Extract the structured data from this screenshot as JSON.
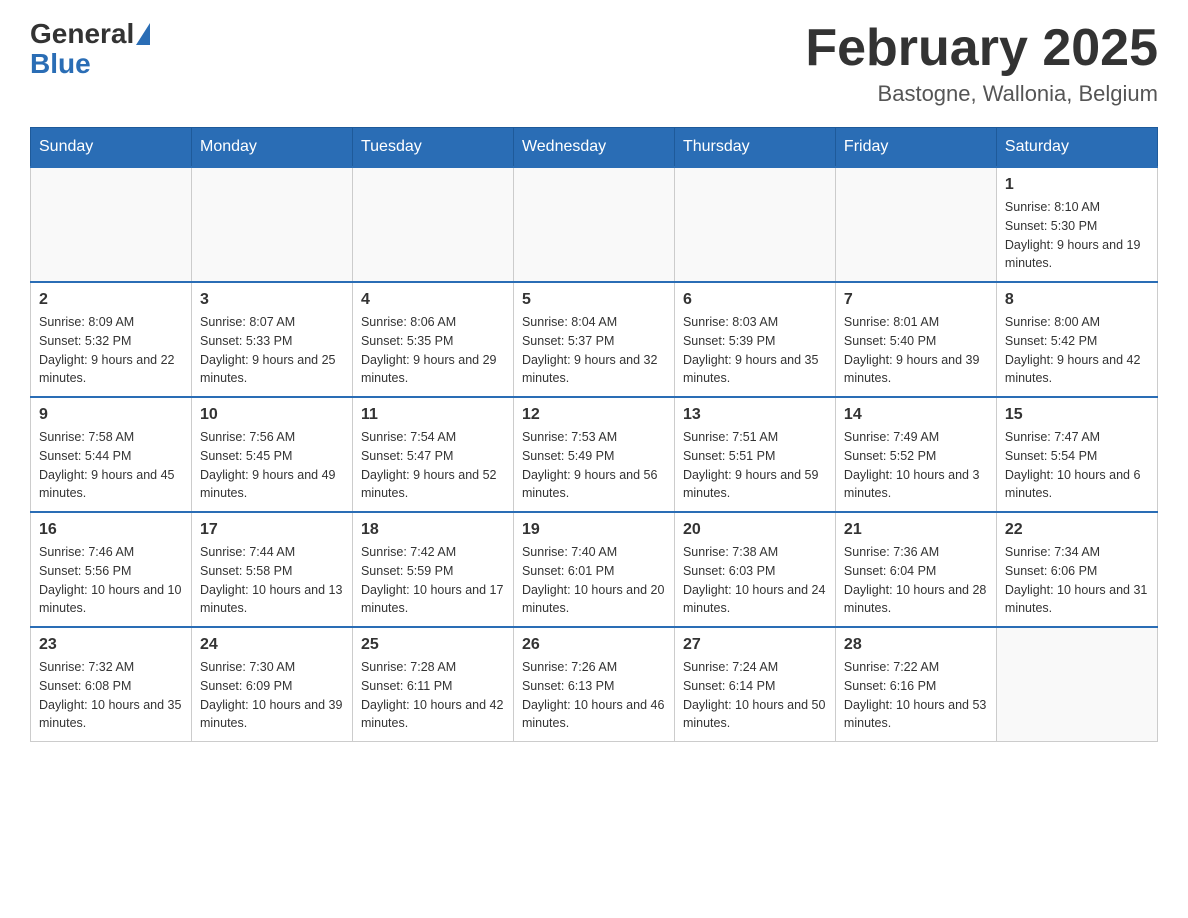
{
  "header": {
    "logo": {
      "part1": "General",
      "part2": "Blue"
    },
    "title": "February 2025",
    "location": "Bastogne, Wallonia, Belgium"
  },
  "days_of_week": [
    "Sunday",
    "Monday",
    "Tuesday",
    "Wednesday",
    "Thursday",
    "Friday",
    "Saturday"
  ],
  "weeks": [
    [
      {
        "day": "",
        "info": ""
      },
      {
        "day": "",
        "info": ""
      },
      {
        "day": "",
        "info": ""
      },
      {
        "day": "",
        "info": ""
      },
      {
        "day": "",
        "info": ""
      },
      {
        "day": "",
        "info": ""
      },
      {
        "day": "1",
        "info": "Sunrise: 8:10 AM\nSunset: 5:30 PM\nDaylight: 9 hours and 19 minutes."
      }
    ],
    [
      {
        "day": "2",
        "info": "Sunrise: 8:09 AM\nSunset: 5:32 PM\nDaylight: 9 hours and 22 minutes."
      },
      {
        "day": "3",
        "info": "Sunrise: 8:07 AM\nSunset: 5:33 PM\nDaylight: 9 hours and 25 minutes."
      },
      {
        "day": "4",
        "info": "Sunrise: 8:06 AM\nSunset: 5:35 PM\nDaylight: 9 hours and 29 minutes."
      },
      {
        "day": "5",
        "info": "Sunrise: 8:04 AM\nSunset: 5:37 PM\nDaylight: 9 hours and 32 minutes."
      },
      {
        "day": "6",
        "info": "Sunrise: 8:03 AM\nSunset: 5:39 PM\nDaylight: 9 hours and 35 minutes."
      },
      {
        "day": "7",
        "info": "Sunrise: 8:01 AM\nSunset: 5:40 PM\nDaylight: 9 hours and 39 minutes."
      },
      {
        "day": "8",
        "info": "Sunrise: 8:00 AM\nSunset: 5:42 PM\nDaylight: 9 hours and 42 minutes."
      }
    ],
    [
      {
        "day": "9",
        "info": "Sunrise: 7:58 AM\nSunset: 5:44 PM\nDaylight: 9 hours and 45 minutes."
      },
      {
        "day": "10",
        "info": "Sunrise: 7:56 AM\nSunset: 5:45 PM\nDaylight: 9 hours and 49 minutes."
      },
      {
        "day": "11",
        "info": "Sunrise: 7:54 AM\nSunset: 5:47 PM\nDaylight: 9 hours and 52 minutes."
      },
      {
        "day": "12",
        "info": "Sunrise: 7:53 AM\nSunset: 5:49 PM\nDaylight: 9 hours and 56 minutes."
      },
      {
        "day": "13",
        "info": "Sunrise: 7:51 AM\nSunset: 5:51 PM\nDaylight: 9 hours and 59 minutes."
      },
      {
        "day": "14",
        "info": "Sunrise: 7:49 AM\nSunset: 5:52 PM\nDaylight: 10 hours and 3 minutes."
      },
      {
        "day": "15",
        "info": "Sunrise: 7:47 AM\nSunset: 5:54 PM\nDaylight: 10 hours and 6 minutes."
      }
    ],
    [
      {
        "day": "16",
        "info": "Sunrise: 7:46 AM\nSunset: 5:56 PM\nDaylight: 10 hours and 10 minutes."
      },
      {
        "day": "17",
        "info": "Sunrise: 7:44 AM\nSunset: 5:58 PM\nDaylight: 10 hours and 13 minutes."
      },
      {
        "day": "18",
        "info": "Sunrise: 7:42 AM\nSunset: 5:59 PM\nDaylight: 10 hours and 17 minutes."
      },
      {
        "day": "19",
        "info": "Sunrise: 7:40 AM\nSunset: 6:01 PM\nDaylight: 10 hours and 20 minutes."
      },
      {
        "day": "20",
        "info": "Sunrise: 7:38 AM\nSunset: 6:03 PM\nDaylight: 10 hours and 24 minutes."
      },
      {
        "day": "21",
        "info": "Sunrise: 7:36 AM\nSunset: 6:04 PM\nDaylight: 10 hours and 28 minutes."
      },
      {
        "day": "22",
        "info": "Sunrise: 7:34 AM\nSunset: 6:06 PM\nDaylight: 10 hours and 31 minutes."
      }
    ],
    [
      {
        "day": "23",
        "info": "Sunrise: 7:32 AM\nSunset: 6:08 PM\nDaylight: 10 hours and 35 minutes."
      },
      {
        "day": "24",
        "info": "Sunrise: 7:30 AM\nSunset: 6:09 PM\nDaylight: 10 hours and 39 minutes."
      },
      {
        "day": "25",
        "info": "Sunrise: 7:28 AM\nSunset: 6:11 PM\nDaylight: 10 hours and 42 minutes."
      },
      {
        "day": "26",
        "info": "Sunrise: 7:26 AM\nSunset: 6:13 PM\nDaylight: 10 hours and 46 minutes."
      },
      {
        "day": "27",
        "info": "Sunrise: 7:24 AM\nSunset: 6:14 PM\nDaylight: 10 hours and 50 minutes."
      },
      {
        "day": "28",
        "info": "Sunrise: 7:22 AM\nSunset: 6:16 PM\nDaylight: 10 hours and 53 minutes."
      },
      {
        "day": "",
        "info": ""
      }
    ]
  ]
}
